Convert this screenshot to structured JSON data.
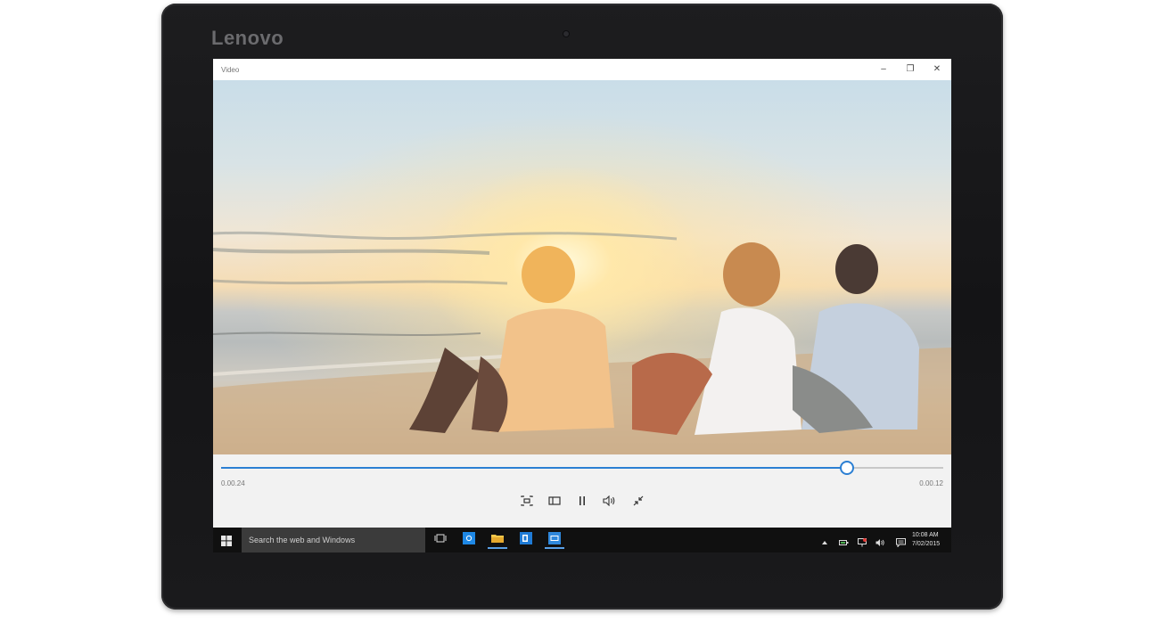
{
  "device": {
    "brand": "Lenovo"
  },
  "window": {
    "title": "Video",
    "minimize_label": "–",
    "restore_label": "❐",
    "close_label": "✕"
  },
  "player": {
    "elapsed": "0.00.24",
    "remaining": "0.00.12",
    "progress": 0.865,
    "accent_color": "#2b7fd3"
  },
  "controls": [
    {
      "icon": "cast-icon"
    },
    {
      "icon": "aspect-ratio-icon"
    },
    {
      "icon": "pause-icon"
    },
    {
      "icon": "volume-icon"
    },
    {
      "icon": "exit-fullscreen-icon"
    }
  ],
  "taskbar": {
    "search_placeholder": "Search the web and Windows",
    "pinned": [
      {
        "icon": "task-view-icon"
      },
      {
        "icon": "store-icon"
      },
      {
        "icon": "file-explorer-icon",
        "active": true
      },
      {
        "icon": "outlook-icon"
      },
      {
        "icon": "video-app-icon",
        "active": true
      }
    ],
    "tray": [
      {
        "icon": "show-hidden-icons-icon"
      },
      {
        "icon": "battery-icon"
      },
      {
        "icon": "network-icon"
      },
      {
        "icon": "volume-icon"
      },
      {
        "icon": "action-center-icon"
      }
    ],
    "time": "10:08 AM",
    "date": "7/02/2015"
  }
}
